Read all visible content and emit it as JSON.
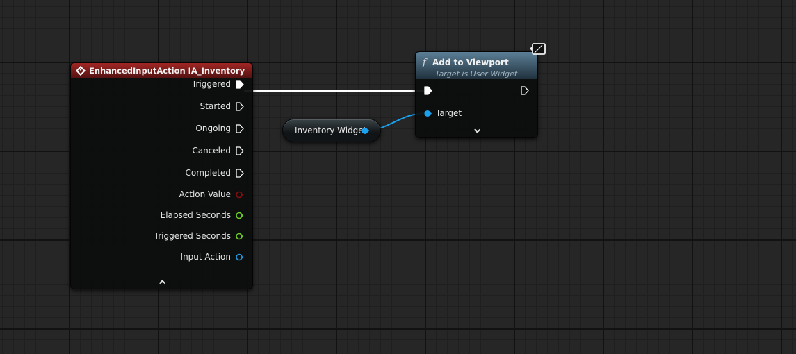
{
  "event_node": {
    "title": "EnhancedInputAction IA_Inventory",
    "header_color": "#a02624",
    "pins": [
      {
        "label": "Triggered",
        "kind": "exec",
        "connected": true
      },
      {
        "label": "Started",
        "kind": "exec",
        "connected": false
      },
      {
        "label": "Ongoing",
        "kind": "exec",
        "connected": false
      },
      {
        "label": "Canceled",
        "kind": "exec",
        "connected": false
      },
      {
        "label": "Completed",
        "kind": "exec",
        "connected": false
      },
      {
        "label": "Action Value",
        "kind": "data",
        "color": "#8a0e0e"
      },
      {
        "label": "Elapsed Seconds",
        "kind": "data",
        "color": "#6fd129"
      },
      {
        "label": "Triggered Seconds",
        "kind": "data",
        "color": "#6fd129"
      },
      {
        "label": "Input Action",
        "kind": "data",
        "color": "#1f9be0"
      }
    ],
    "collapse_icon": "chevron-up-icon"
  },
  "variable_node": {
    "label": "Inventory Widget",
    "pin_color": "#1aa2f2"
  },
  "function_node": {
    "title": "Add to Viewport",
    "subtitle": "Target is User Widget",
    "function_icon": "f",
    "header_color": "#5c7f96",
    "target_label": "Target",
    "target_pin_color": "#1aa2f2",
    "expand_icon": "chevron-down-icon",
    "context_icon": "monitor-icon"
  },
  "wire_colors": {
    "exec": "#ffffff",
    "object": "#1aa2f2"
  }
}
